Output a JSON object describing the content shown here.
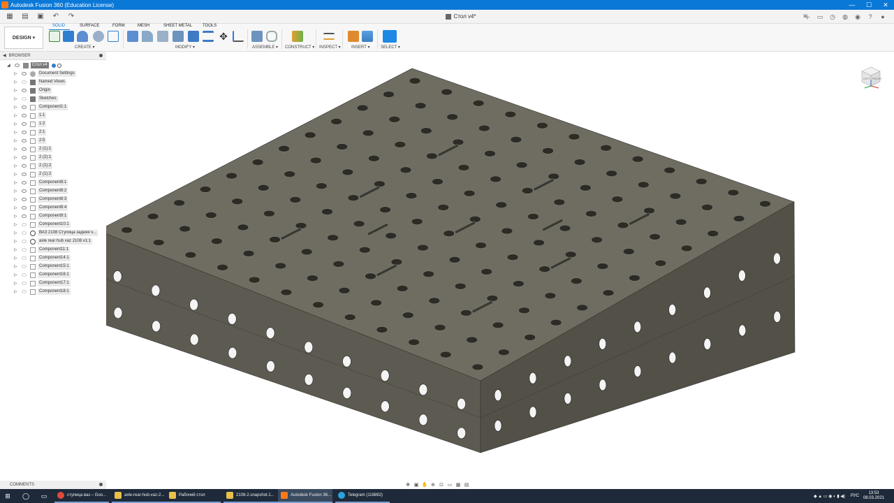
{
  "titlebar": {
    "title": "Autodesk Fusion 360 (Education License)",
    "minimize": "—",
    "maximize": "☐",
    "close": "✕"
  },
  "document_tab": {
    "name": "Стол v4*"
  },
  "ribbon": {
    "workspace": "DESIGN ▾",
    "tabs": [
      "SOLID",
      "SURFACE",
      "FORM",
      "MESH",
      "SHEET METAL",
      "TOOLS"
    ],
    "groups": [
      "CREATE ▾",
      "MODIFY ▾",
      "ASSEMBLE ▾",
      "CONSTRUCT ▾",
      "INSPECT ▾",
      "INSERT ▾",
      "SELECT ▾"
    ]
  },
  "browser": {
    "header": "BROWSER",
    "items": [
      "Стол v4",
      "Document Settings",
      "Named Views",
      "Origin",
      "Sketches",
      "Component1:1",
      "1:1",
      "1:2",
      "2:1",
      "2:5",
      "2 (1):1",
      "2 (2):1",
      "2 (2):2",
      "2 (1):2",
      "Component8:1",
      "Component8:2",
      "Component8:3",
      "Component8:4",
      "Component9:1",
      "Component10:1",
      "ВАЗ 2108 Ступица задняя v...",
      "axle rear hub vaz 2108 v1:1",
      "Component11:1",
      "Component14:1",
      "Component15:1",
      "Component16:1",
      "Component17:1",
      "Component18:1"
    ]
  },
  "comments": {
    "label": "COMMENTS"
  },
  "viewcube": {
    "left": "LEFT",
    "front": "FRONT"
  },
  "taskbar": {
    "apps": [
      "ступица ваз – Goo...",
      "axle-rear-hub-vaz-2...",
      "Рабочий стол",
      "2108-2.snapshot.1...",
      "Autodesk Fusion 36...",
      "Telegram (116892)"
    ],
    "lang": "РУС",
    "time": "13:53",
    "date": "08.03.2021"
  },
  "colors": {
    "title_bar": "#0a78d7",
    "model_top": "#6c6a5e",
    "model_left": "#5a584e",
    "model_right": "#4e4c43",
    "taskbar": "#1e2a3a"
  }
}
